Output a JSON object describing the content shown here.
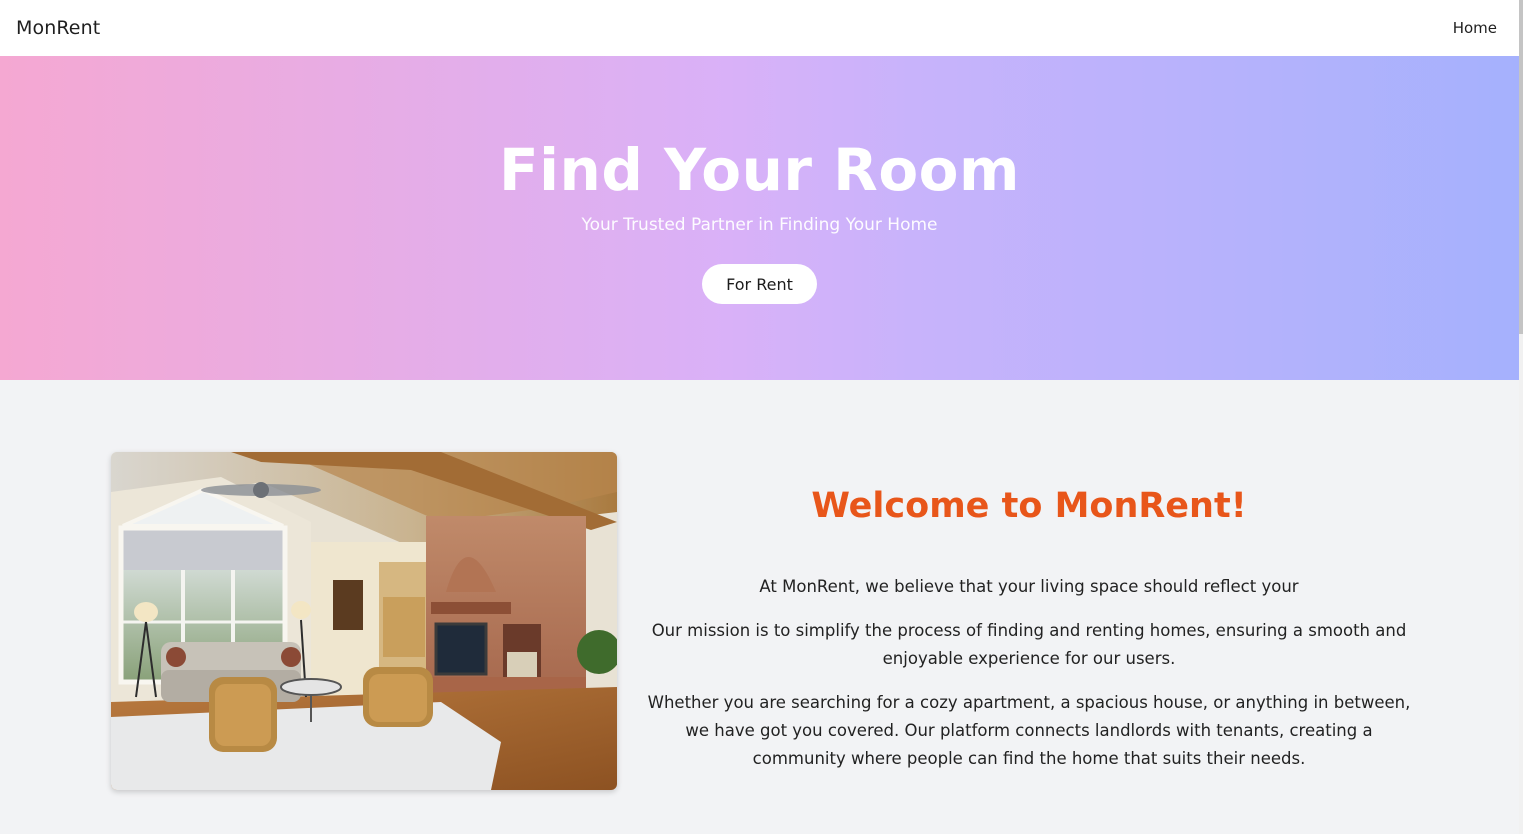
{
  "navbar": {
    "brand": "MonRent",
    "links": [
      {
        "label": "Home"
      }
    ]
  },
  "hero": {
    "title": "Find Your Room",
    "subtitle": "Your Trusted Partner in Finding Your Home",
    "cta_label": "For Rent"
  },
  "about": {
    "heading": "Welcome to MonRent!",
    "paragraphs": [
      "At MonRent, we believe that your living space should reflect your",
      "Our mission is to simplify the process of finding and renting homes, ensuring a smooth and enjoyable experience for our users.",
      "Whether you are searching for a cozy apartment, a spacious house, or anything in between, we have got you covered. Our platform connects landlords with tenants, creating a community where people can find the home that suits their needs."
    ]
  },
  "colors": {
    "accent": "#e8561a",
    "hero_gradient_start": "#f5a8d2",
    "hero_gradient_end": "#a5b1fd"
  }
}
